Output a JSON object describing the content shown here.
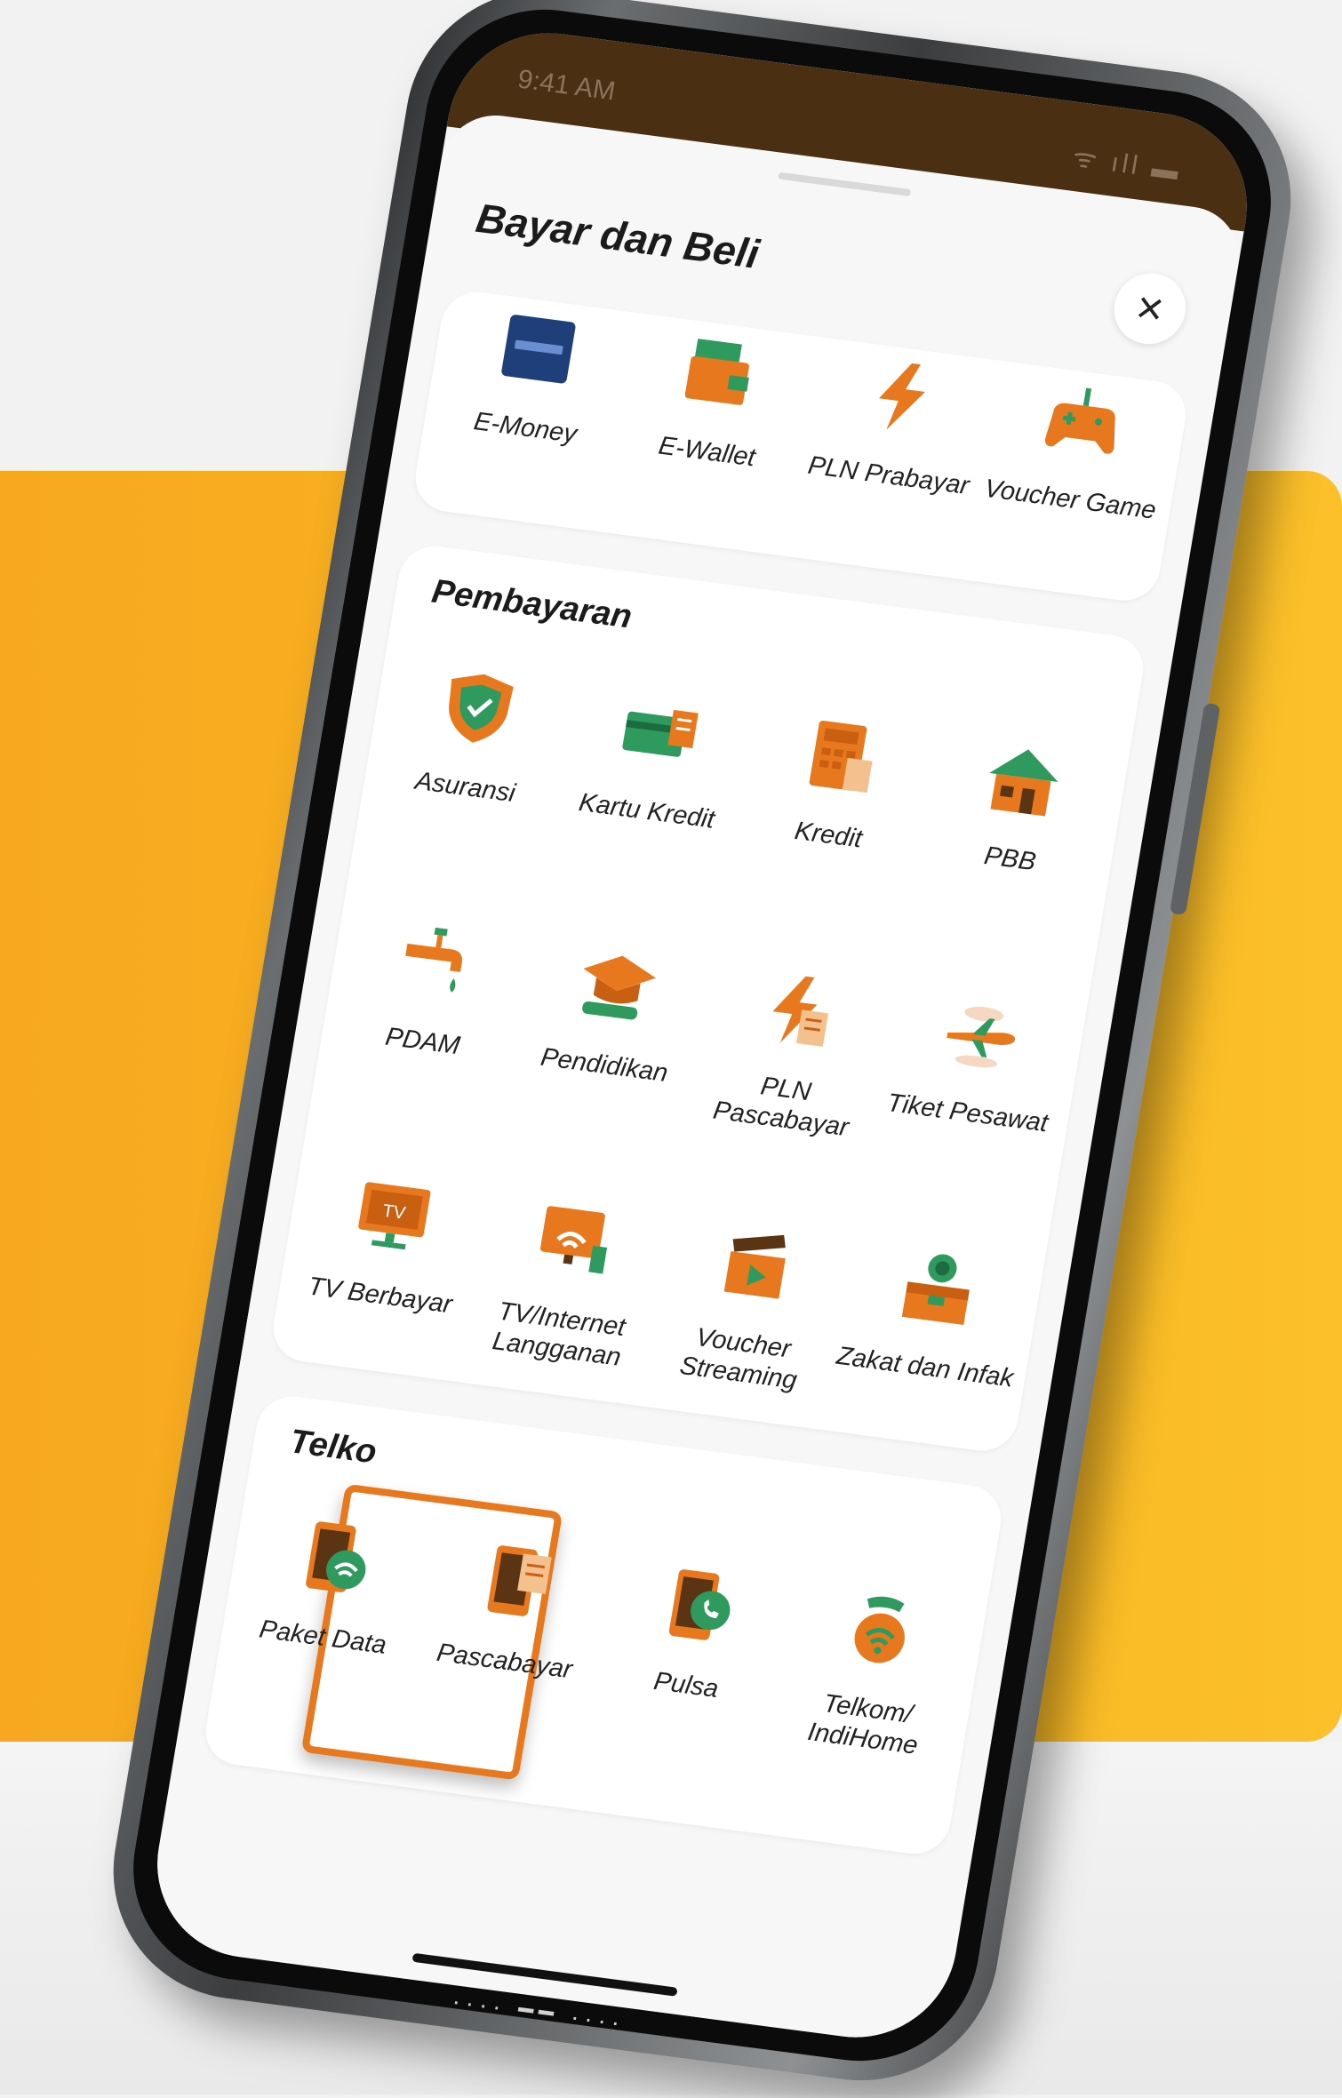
{
  "status_bar": {
    "time": "9:41 AM",
    "icons": "ᯤ ıll ▬"
  },
  "sheet": {
    "title": "Bayar dan Beli",
    "close_icon": "×"
  },
  "quick": [
    {
      "label": "E-Money",
      "icon": "emoney-card-icon"
    },
    {
      "label": "E-Wallet",
      "icon": "wallet-icon"
    },
    {
      "label": "PLN Prabayar",
      "icon": "lightning-icon"
    },
    {
      "label": "Voucher Game",
      "icon": "gamepad-icon"
    }
  ],
  "pembayaran": {
    "title": "Pembayaran",
    "items": [
      {
        "label": "Asuransi",
        "icon": "shield-icon"
      },
      {
        "label": "Kartu Kredit",
        "icon": "credit-card-icon"
      },
      {
        "label": "Kredit",
        "icon": "calculator-icon"
      },
      {
        "label": "PBB",
        "icon": "house-icon"
      },
      {
        "label": "PDAM",
        "icon": "faucet-icon"
      },
      {
        "label": "Pendidikan",
        "icon": "graduation-cap-icon"
      },
      {
        "label": "PLN Pascabayar",
        "icon": "lightning-bill-icon"
      },
      {
        "label": "Tiket Pesawat",
        "icon": "airplane-icon"
      },
      {
        "label": "TV Berbayar",
        "icon": "tv-icon"
      },
      {
        "label": "TV/Internet Langganan",
        "icon": "tv-wifi-icon"
      },
      {
        "label": "Voucher Streaming",
        "icon": "clapperboard-icon"
      },
      {
        "label": "Zakat dan Infak",
        "icon": "charity-box-icon"
      }
    ]
  },
  "telko": {
    "title": "Telko",
    "items": [
      {
        "label": "Paket Data",
        "icon": "phone-wifi-icon"
      },
      {
        "label": "Pascabayar",
        "icon": "phone-bill-icon",
        "selected": true
      },
      {
        "label": "Pulsa",
        "icon": "phone-call-icon"
      },
      {
        "label": "Telkom/ IndiHome",
        "icon": "telephone-wifi-icon"
      }
    ]
  },
  "colors": {
    "accent": "#e8781e",
    "green": "#2f9a5e",
    "status_bar": "#4a2f12",
    "background": "#f9b622"
  },
  "bottom_ports": "····   ━━   ····"
}
